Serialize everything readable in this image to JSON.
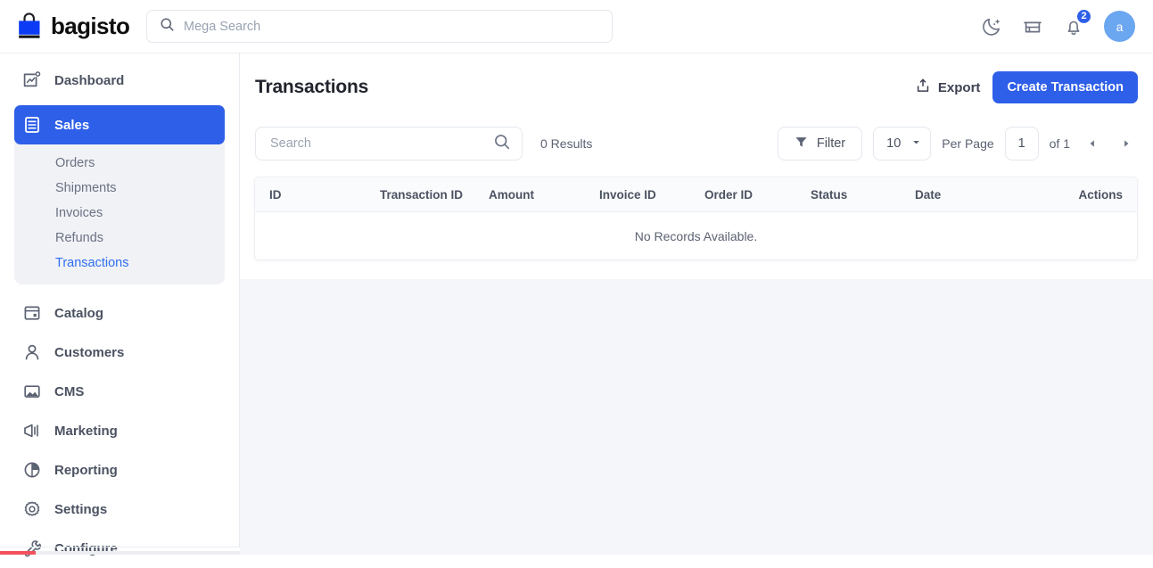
{
  "topbar": {
    "brand_name": "bagisto",
    "brand_logo_icon": "shopping-bag-icon",
    "mega_search_placeholder": "Mega Search",
    "search_icon": "search-icon",
    "dark_mode_icon": "moon-icon",
    "store_icon": "storefront-icon",
    "notification_icon": "bell-icon",
    "notification_count": "2",
    "avatar_initial": "a",
    "accent_color": "#2e5fe8",
    "avatar_color": "#6ba6f0"
  },
  "sidebar": {
    "items": [
      {
        "label": "Dashboard",
        "icon": "chart-square-icon"
      },
      {
        "label": "Sales",
        "icon": "list-document-icon",
        "active": true
      },
      {
        "label": "Catalog",
        "icon": "catalog-grid-icon"
      },
      {
        "label": "Customers",
        "icon": "user-icon"
      },
      {
        "label": "CMS",
        "icon": "image-icon"
      },
      {
        "label": "Marketing",
        "icon": "megaphone-icon"
      },
      {
        "label": "Reporting",
        "icon": "pie-chart-icon"
      },
      {
        "label": "Settings",
        "icon": "gear-icon"
      },
      {
        "label": "Configure",
        "icon": "wrench-icon"
      }
    ],
    "sales_subitems": [
      {
        "label": "Orders"
      },
      {
        "label": "Shipments"
      },
      {
        "label": "Invoices"
      },
      {
        "label": "Refunds"
      },
      {
        "label": "Transactions",
        "active": true
      }
    ]
  },
  "page": {
    "title": "Transactions",
    "export_label": "Export",
    "export_icon": "upload-box-icon",
    "create_label": "Create Transaction"
  },
  "toolbar": {
    "search_placeholder": "Search",
    "search_icon": "search-icon",
    "results_text": "0 Results",
    "filter_label": "Filter",
    "filter_icon": "funnel-icon",
    "per_page_value": "10",
    "per_page_chevron": "chevron-down-icon",
    "per_page_label": "Per Page",
    "page_value": "1",
    "of_label": "of 1",
    "prev_icon": "triangle-left-icon",
    "next_icon": "triangle-right-icon"
  },
  "table": {
    "columns": [
      "ID",
      "Transaction ID",
      "Amount",
      "Invoice ID",
      "Order ID",
      "Status",
      "Date",
      "Actions"
    ],
    "rows": [],
    "empty_message": "No Records Available."
  },
  "progress": {
    "color": "#f4505c"
  }
}
